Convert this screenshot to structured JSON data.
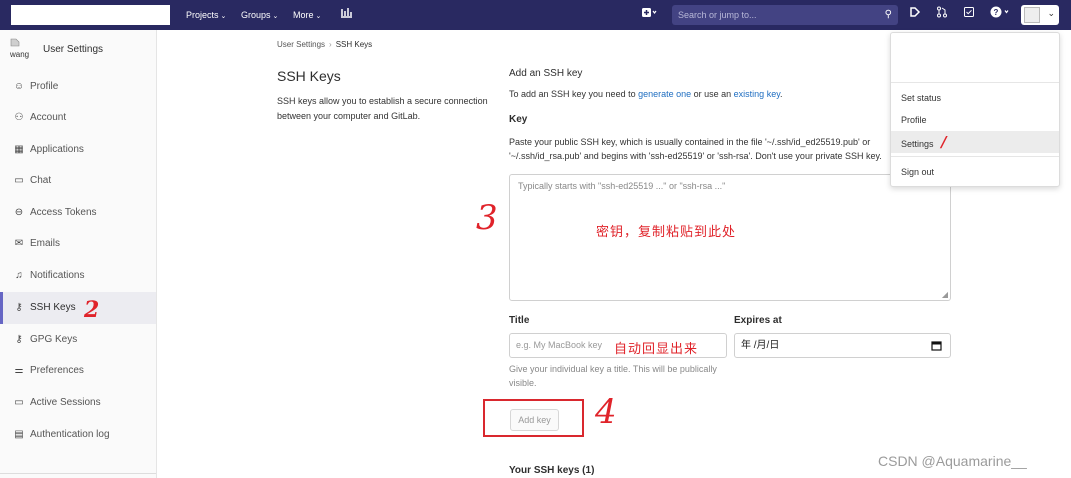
{
  "navbar": {
    "projects": "Projects",
    "groups": "Groups",
    "more": "More",
    "search_placeholder": "Search or jump to..."
  },
  "sidebar": {
    "avatar_alt": "wang",
    "title": "User Settings",
    "items": [
      {
        "label": "Profile",
        "icon": "profile-icon"
      },
      {
        "label": "Account",
        "icon": "account-icon"
      },
      {
        "label": "Applications",
        "icon": "applications-icon"
      },
      {
        "label": "Chat",
        "icon": "chat-icon"
      },
      {
        "label": "Access Tokens",
        "icon": "token-icon"
      },
      {
        "label": "Emails",
        "icon": "mail-icon"
      },
      {
        "label": "Notifications",
        "icon": "bell-icon"
      },
      {
        "label": "SSH Keys",
        "icon": "key-icon"
      },
      {
        "label": "GPG Keys",
        "icon": "key-icon"
      },
      {
        "label": "Preferences",
        "icon": "preferences-icon"
      },
      {
        "label": "Active Sessions",
        "icon": "monitor-icon"
      },
      {
        "label": "Authentication log",
        "icon": "log-icon"
      }
    ],
    "active": "SSH Keys"
  },
  "breadcrumb": {
    "parent": "User Settings",
    "sep": "›",
    "current": "SSH Keys"
  },
  "page": {
    "heading": "SSH Keys",
    "description": "SSH keys allow you to establish a secure connection between your computer and GitLab.",
    "add_title": "Add an SSH key",
    "add_desc_1": "To add an SSH key you need to ",
    "add_link_1": "generate one",
    "add_desc_2": " or use an ",
    "add_link_2": "existing key",
    "add_desc_3": ".",
    "key_label": "Key",
    "paste_help_line1": "Paste your public SSH key, which is usually contained in the file '~/.ssh/id_ed25519.pub' or",
    "paste_help_line2": "'~/.ssh/id_rsa.pub' and begins with 'ssh-ed25519' or 'ssh-rsa'. Don't use your private SSH key.",
    "key_placeholder": "Typically starts with \"ssh-ed25519 ...\" or \"ssh-rsa ...\"",
    "title_label": "Title",
    "title_placeholder": "e.g. My MacBook key",
    "expires_label": "Expires at",
    "expires_value": "年 /月/日",
    "title_hint": "Give your individual key a title. This will be publically visible.",
    "add_button": "Add key",
    "your_keys": "Your SSH keys (1)"
  },
  "dropdown": {
    "items": [
      "Set status",
      "Profile",
      "Settings",
      "Sign out"
    ],
    "highlighted": "Settings"
  },
  "annotations": {
    "num_1": "/",
    "num_2": "2",
    "num_3": "3",
    "num_4": "4",
    "paste_here": "密钥，复制粘贴到此处",
    "auto_show": "自动回显出来"
  },
  "watermark": "CSDN @Aquamarine__",
  "colors": {
    "navbar": "#292961",
    "active_border": "#6666c4",
    "link": "#1f6ec1",
    "annotation": "#e0232a"
  }
}
